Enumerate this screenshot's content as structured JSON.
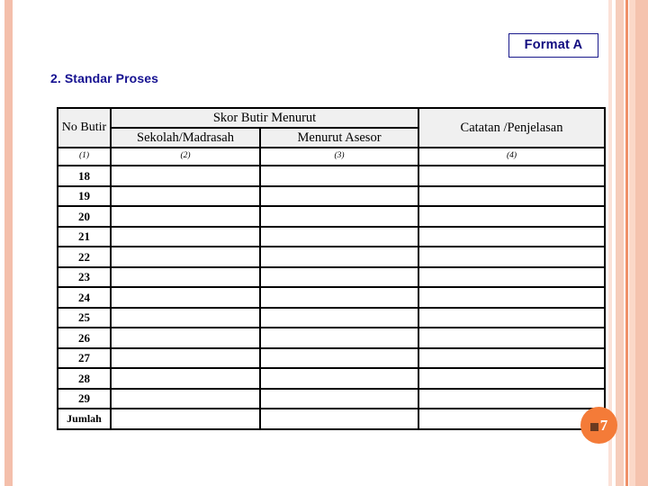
{
  "page": {
    "format_badge": "Format A",
    "section_heading": "2. Standar Proses",
    "page_number": "7"
  },
  "table": {
    "header": {
      "col_no": "No Butir",
      "group_skor": "Skor Butir Menurut",
      "sub_sekolah": "Sekolah/Madrasah",
      "sub_asesor": "Menurut Asesor",
      "col_catatan": "Catatan /Penjelasan"
    },
    "number_row": [
      "(1)",
      "(2)",
      "(3)",
      "(4)"
    ],
    "rows": [
      {
        "no": "18",
        "sekolah": "",
        "asesor": "",
        "catatan": ""
      },
      {
        "no": "19",
        "sekolah": "",
        "asesor": "",
        "catatan": ""
      },
      {
        "no": "20",
        "sekolah": "",
        "asesor": "",
        "catatan": ""
      },
      {
        "no": "21",
        "sekolah": "",
        "asesor": "",
        "catatan": ""
      },
      {
        "no": "22",
        "sekolah": "",
        "asesor": "",
        "catatan": ""
      },
      {
        "no": "23",
        "sekolah": "",
        "asesor": "",
        "catatan": ""
      },
      {
        "no": "24",
        "sekolah": "",
        "asesor": "",
        "catatan": ""
      },
      {
        "no": "25",
        "sekolah": "",
        "asesor": "",
        "catatan": ""
      },
      {
        "no": "26",
        "sekolah": "",
        "asesor": "",
        "catatan": ""
      },
      {
        "no": "27",
        "sekolah": "",
        "asesor": "",
        "catatan": ""
      },
      {
        "no": "28",
        "sekolah": "",
        "asesor": "",
        "catatan": ""
      },
      {
        "no": "29",
        "sekolah": "",
        "asesor": "",
        "catatan": ""
      },
      {
        "no": "Jumlah",
        "sekolah": "",
        "asesor": "",
        "catatan": ""
      }
    ]
  },
  "colors": {
    "heading_navy": "#161291",
    "badge_orange": "#f47b38",
    "stripe_peach": "#f4bfab",
    "header_fill": "#f0f0f0"
  }
}
